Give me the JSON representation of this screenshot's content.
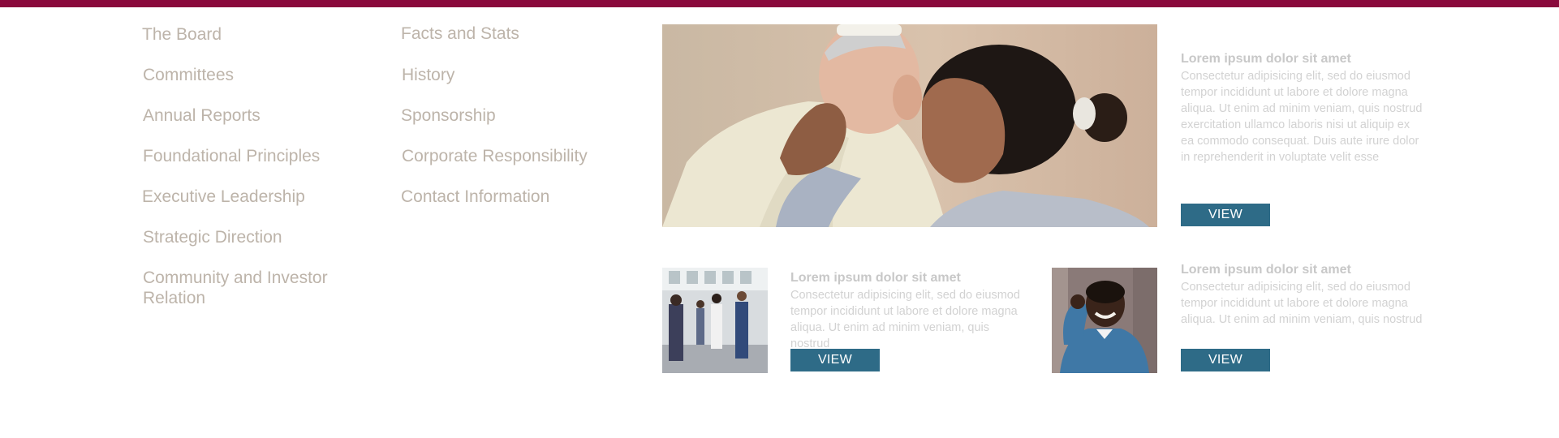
{
  "nav": {
    "col1": [
      "The Board",
      "Committees",
      "Annual Reports",
      "Foundational Principles",
      "Executive Leadership",
      "Strategic Direction",
      "Community and Investor Relation"
    ],
    "col2": [
      "Facts and Stats",
      "History",
      "Sponsorship",
      "Corporate Responsibility",
      "Contact Information"
    ]
  },
  "featured": {
    "title": "Lorem ipsum dolor sit amet",
    "body": "Consectetur adipisicing elit, sed do eiusmod tempor incididunt ut labore et dolore magna aliqua. Ut enim ad minim veniam, quis nostrud exercitation ullamco laboris nisi ut aliquip ex ea commodo consequat. Duis aute irure dolor in reprehenderit in voluptate velit esse",
    "button": "VIEW"
  },
  "card_left": {
    "title": "Lorem ipsum dolor sit amet",
    "body": "Consectetur adipisicing elit, sed do eiusmod tempor incididunt ut labore et dolore magna aliqua. Ut enim ad minim veniam, quis nostrud",
    "button": "VIEW"
  },
  "card_right": {
    "title": "Lorem ipsum dolor sit amet",
    "body": "Consectetur adipisicing elit, sed do eiusmod tempor incididunt ut labore et dolore magna aliqua. Ut enim ad minim veniam, quis nostrud",
    "button": "VIEW"
  },
  "colors": {
    "top_bar": "#8a0a3c",
    "nav_text": "#bdb4aa",
    "button": "#2e6b87"
  }
}
